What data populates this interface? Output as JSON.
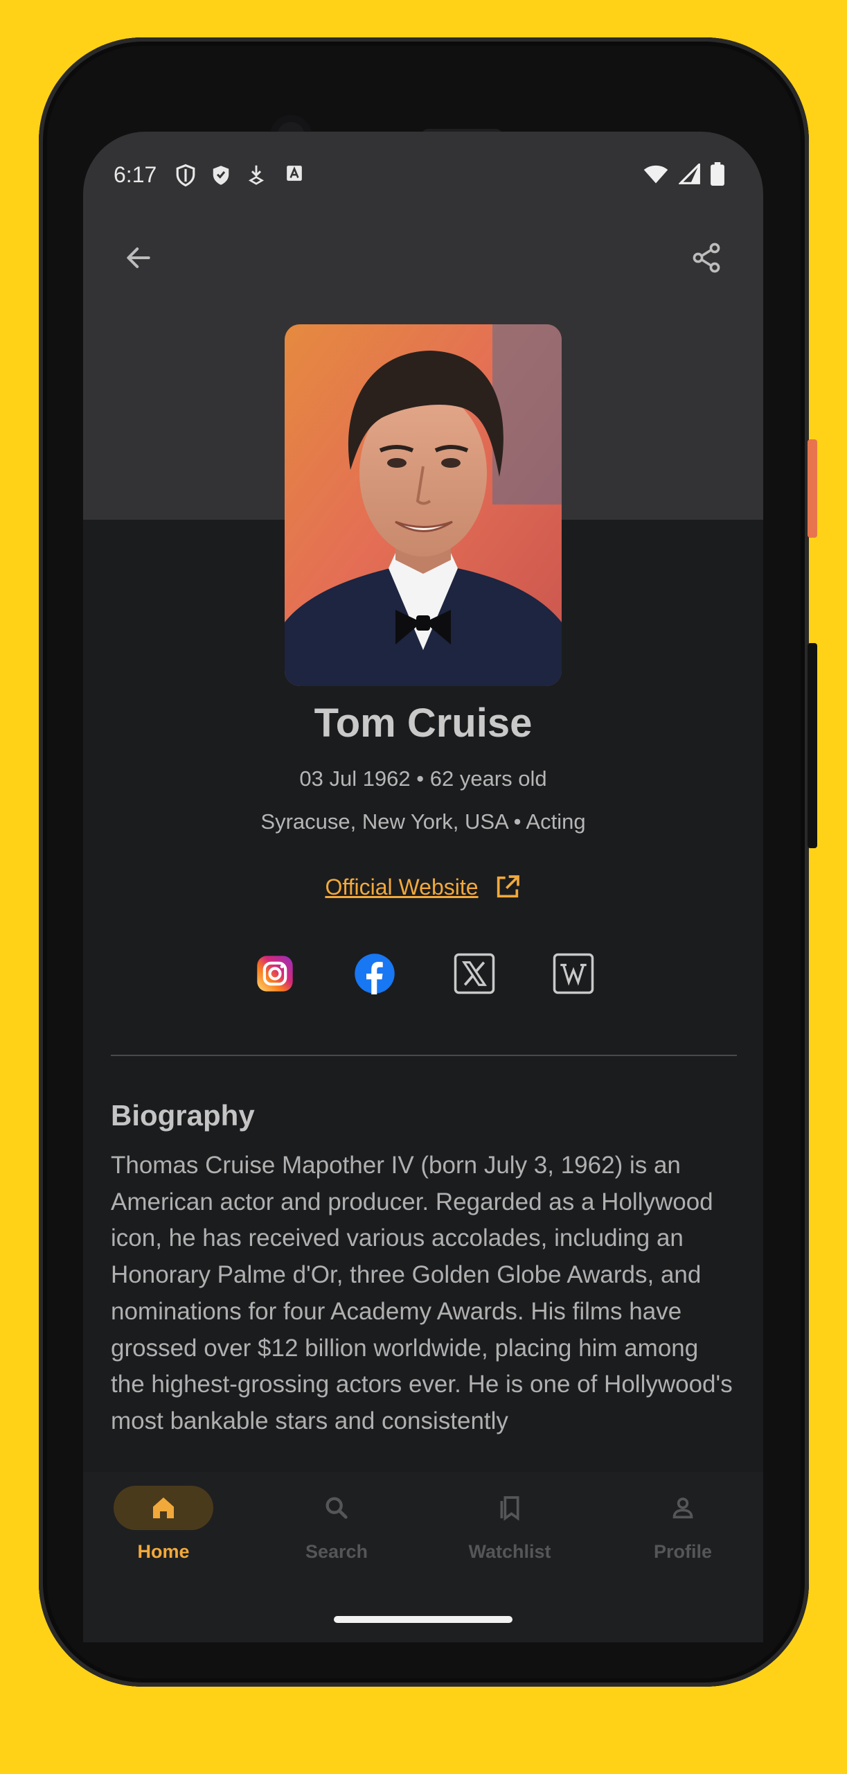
{
  "status_bar": {
    "time": "6:17",
    "icons": [
      "shield-outline-icon",
      "shield-check-icon",
      "download-icon",
      "a-icon"
    ],
    "right_icons": [
      "wifi-icon",
      "signal-icon",
      "battery-icon"
    ]
  },
  "person": {
    "name": "Tom Cruise",
    "birth_line": "03 Jul 1962 • 62 years old",
    "place_line": "Syracuse, New York, USA • Acting",
    "website_label": "Official Website"
  },
  "socials": [
    "instagram",
    "facebook",
    "x",
    "wikipedia"
  ],
  "biography": {
    "title": "Biography",
    "text": "Thomas Cruise Mapother IV (born July 3, 1962) is an American actor and producer. Regarded as a Hollywood icon, he has received various accolades, including an Honorary Palme d'Or, three Golden Globe Awards, and nominations for four Academy Awards. His films have grossed over $12 billion worldwide, placing him among the highest-grossing actors ever. He is one of Hollywood's most bankable stars and consistently"
  },
  "nav": {
    "items": [
      {
        "label": "Home",
        "icon": "home-icon",
        "active": true
      },
      {
        "label": "Search",
        "icon": "search-icon",
        "active": false
      },
      {
        "label": "Watchlist",
        "icon": "watchlist-icon",
        "active": false
      },
      {
        "label": "Profile",
        "icon": "profile-icon",
        "active": false
      }
    ]
  },
  "colors": {
    "accent": "#F2A93B",
    "background": "#1B1C1E",
    "header": "#333335",
    "frame": "#FFD218"
  }
}
